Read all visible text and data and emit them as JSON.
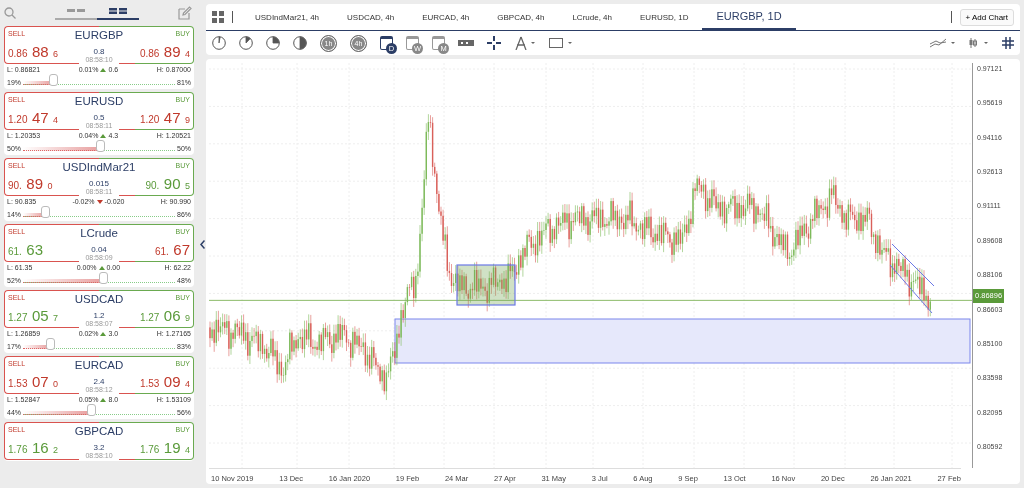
{
  "sidebar": {
    "views": [
      {
        "selected": false
      },
      {
        "selected": true
      }
    ],
    "quotes": [
      {
        "symbol": "EURGBP",
        "sell_label": "SELL",
        "buy_label": "BUY",
        "sell": {
          "prefix": "0.86",
          "big": "88",
          "pip": "6",
          "rising": false
        },
        "buy": {
          "prefix": "0.86",
          "big": "89",
          "pip": "4",
          "rising": false
        },
        "spread": "0.8",
        "time": "08:58:10",
        "low": "L: 0.86821",
        "change_pct": "0.01%",
        "change_up": true,
        "change": "0.6",
        "high": "H: 0.87000",
        "sell_pct": "19%",
        "buy_pct": "81%",
        "level": 0.19
      },
      {
        "symbol": "EURUSD",
        "sell_label": "SELL",
        "buy_label": "BUY",
        "sell": {
          "prefix": "1.20",
          "big": "47",
          "pip": "4",
          "rising": false
        },
        "buy": {
          "prefix": "1.20",
          "big": "47",
          "pip": "9",
          "rising": false
        },
        "spread": "0.5",
        "time": "08:58:11",
        "low": "L: 1.20353",
        "change_pct": "0.04%",
        "change_up": true,
        "change": "4.3",
        "high": "H: 1.20521",
        "sell_pct": "50%",
        "buy_pct": "50%",
        "level": 0.5
      },
      {
        "symbol": "USDIndMar21",
        "sell_label": "SELL",
        "buy_label": "BUY",
        "sell": {
          "prefix": "90.",
          "big": "89",
          "pip": "0",
          "rising": false
        },
        "buy": {
          "prefix": "90.",
          "big": "90",
          "pip": "5",
          "rising": true
        },
        "spread": "0.015",
        "time": "08:58:11",
        "low": "L: 90.835",
        "change_pct": "-0.02%",
        "change_up": false,
        "change": "-0.020",
        "high": "H: 90.990",
        "sell_pct": "14%",
        "buy_pct": "86%",
        "level": 0.14
      },
      {
        "symbol": "LCrude",
        "sell_label": "SELL",
        "buy_label": "BUY",
        "sell": {
          "prefix": "61.",
          "big": "63",
          "rising": true
        },
        "buy": {
          "prefix": "61.",
          "big": "67",
          "rising": false
        },
        "spread": "0.04",
        "time": "08:58:09",
        "low": "L: 61.35",
        "change_pct": "0.00%",
        "change_up": true,
        "change": "0.00",
        "high": "H: 62.22",
        "sell_pct": "52%",
        "buy_pct": "48%",
        "level": 0.52
      },
      {
        "symbol": "USDCAD",
        "sell_label": "SELL",
        "buy_label": "BUY",
        "sell": {
          "prefix": "1.27",
          "big": "05",
          "pip": "7",
          "rising": true
        },
        "buy": {
          "prefix": "1.27",
          "big": "06",
          "pip": "9",
          "rising": true
        },
        "spread": "1.2",
        "time": "08:58:07",
        "low": "L: 1.26859",
        "change_pct": "0.02%",
        "change_up": true,
        "change": "3.0",
        "high": "H: 1.27165",
        "sell_pct": "17%",
        "buy_pct": "83%",
        "level": 0.17
      },
      {
        "symbol": "EURCAD",
        "sell_label": "SELL",
        "buy_label": "BUY",
        "sell": {
          "prefix": "1.53",
          "big": "07",
          "pip": "0",
          "rising": false
        },
        "buy": {
          "prefix": "1.53",
          "big": "09",
          "pip": "4",
          "rising": false
        },
        "spread": "2.4",
        "time": "08:58:12",
        "low": "L: 1.52847",
        "change_pct": "0.05%",
        "change_up": true,
        "change": "8.0",
        "high": "H: 1.53109",
        "sell_pct": "44%",
        "buy_pct": "56%",
        "level": 0.44
      },
      {
        "symbol": "GBPCAD",
        "sell_label": "SELL",
        "buy_label": "BUY",
        "sell": {
          "prefix": "1.76",
          "big": "16",
          "pip": "2",
          "rising": true
        },
        "buy": {
          "prefix": "1.76",
          "big": "19",
          "pip": "4",
          "rising": true
        },
        "spread": "3.2",
        "time": "08:58:10"
      }
    ]
  },
  "tabs": [
    {
      "label": "USDIndMar21, 4h",
      "selected": false
    },
    {
      "label": "USDCAD, 4h",
      "selected": false
    },
    {
      "label": "EURCAD, 4h",
      "selected": false
    },
    {
      "label": "GBPCAD, 4h",
      "selected": false
    },
    {
      "label": "LCrude, 4h",
      "selected": false
    },
    {
      "label": "EURUSD, 1D",
      "selected": false
    },
    {
      "label": "EURGBP, 1D",
      "selected": true
    }
  ],
  "add_chart": "+ Add Chart",
  "toolbar": [
    {
      "kind": "clock"
    },
    {
      "kind": "clock"
    },
    {
      "kind": "clock"
    },
    {
      "kind": "clock"
    },
    {
      "kind": "timeframe",
      "label": "1h"
    },
    {
      "kind": "timeframe",
      "label": "4h"
    },
    {
      "kind": "calendar",
      "label": "D",
      "selected": true
    },
    {
      "kind": "calendar",
      "label": "W",
      "selected": false
    },
    {
      "kind": "calendar",
      "label": "M",
      "selected": false
    },
    {
      "kind": "ruler"
    },
    {
      "kind": "crosshair"
    },
    {
      "kind": "compass"
    },
    {
      "kind": "rectangle"
    }
  ],
  "chart": {
    "price_labels": [
      "0.97121",
      "0.95619",
      "0.94116",
      "0.92613",
      "0.91111",
      "0.89608",
      "0.88106",
      "0.86603",
      "0.85100",
      "0.83598",
      "0.82095",
      "0.80592"
    ],
    "current_price": "0.86896",
    "date_labels": [
      "10 Nov 2019",
      "13 Dec",
      "16 Jan 2020",
      "19 Feb",
      "24 Mar",
      "27 Apr",
      "31 May",
      "3 Jul",
      "6 Aug",
      "9 Sep",
      "13 Oct",
      "16 Nov",
      "20 Dec",
      "26 Jan 2021",
      "27 Feb"
    ]
  }
}
